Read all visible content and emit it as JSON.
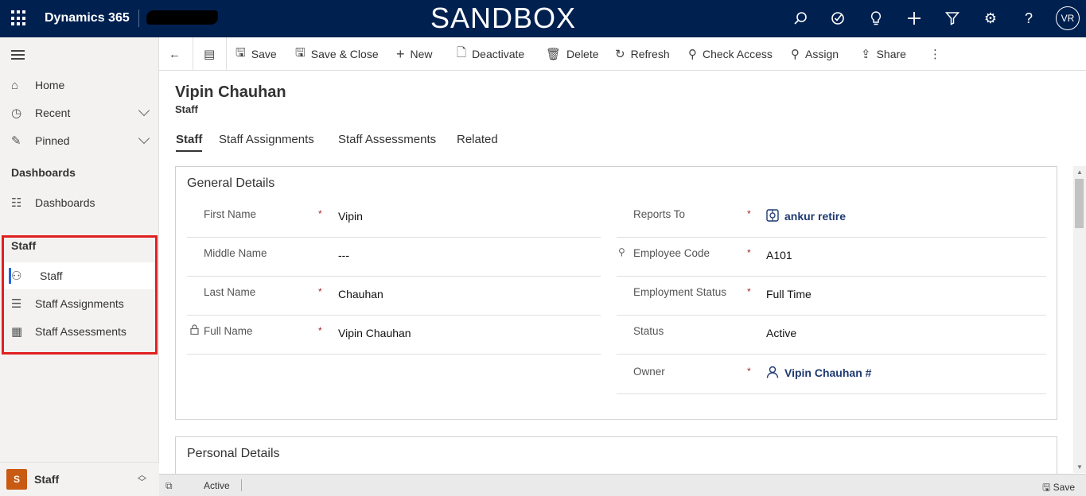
{
  "topbar": {
    "app_name": "Dynamics 365",
    "environment_banner": "SANDBOX",
    "user_initials": "VR",
    "icons": [
      "search-icon",
      "task-icon",
      "lightbulb-icon",
      "plus-icon",
      "filter-icon",
      "gear-icon",
      "help-icon"
    ]
  },
  "sidebar": {
    "home": "Home",
    "recent": "Recent",
    "pinned": "Pinned",
    "dashboards_section": "Dashboards",
    "dashboards_item": "Dashboards",
    "staff_section": "Staff",
    "staff_items": [
      {
        "label": "Staff",
        "active": true
      },
      {
        "label": "Staff Assignments",
        "active": false
      },
      {
        "label": "Staff Assessments",
        "active": false
      }
    ],
    "area_badge": "S",
    "area_name": "Staff"
  },
  "commands": {
    "save": "Save",
    "save_close": "Save & Close",
    "new": "New",
    "deactivate": "Deactivate",
    "delete": "Delete",
    "refresh": "Refresh",
    "check_access": "Check Access",
    "assign": "Assign",
    "share": "Share"
  },
  "record": {
    "title": "Vipin Chauhan",
    "entity": "Staff"
  },
  "tabs": [
    "Staff",
    "Staff Assignments",
    "Staff Assessments",
    "Related"
  ],
  "general": {
    "title": "General Details",
    "left": [
      {
        "label": "First Name",
        "required": "*",
        "value": "Vipin"
      },
      {
        "label": "Middle Name",
        "required": "",
        "value": "---"
      },
      {
        "label": "Last Name",
        "required": "*",
        "value": "Chauhan"
      },
      {
        "label": "Full Name",
        "required": "*",
        "value": "Vipin Chauhan"
      }
    ],
    "right": [
      {
        "label": "Reports To",
        "required": "*",
        "value": "ankur retire"
      },
      {
        "label": "Employee Code",
        "required": "*",
        "value": "A101"
      },
      {
        "label": "Employment Status",
        "required": "*",
        "value": "Full Time"
      },
      {
        "label": "Status",
        "required": "",
        "value": "Active"
      },
      {
        "label": "Owner",
        "required": "*",
        "value": "Vipin Chauhan #"
      }
    ]
  },
  "personal": {
    "title": "Personal Details"
  },
  "statusbar": {
    "status": "Active",
    "save": "Save"
  }
}
